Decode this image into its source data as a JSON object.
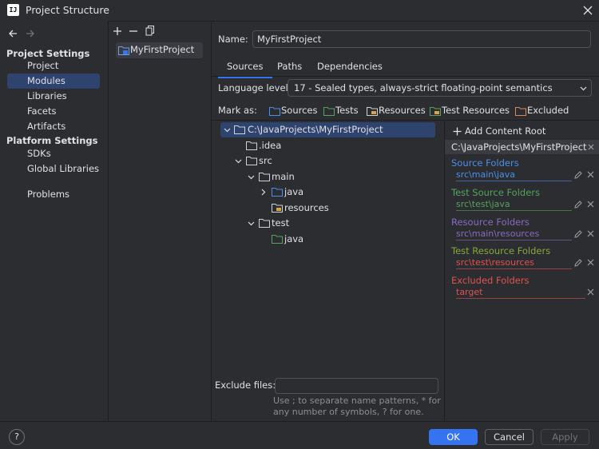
{
  "window": {
    "title": "Project Structure",
    "app_icon_text": "IJ"
  },
  "nav": {
    "project_settings_header": "Project Settings",
    "project_settings_items": [
      "Project",
      "Modules",
      "Libraries",
      "Facets",
      "Artifacts"
    ],
    "platform_settings_header": "Platform Settings",
    "platform_settings_items": [
      "SDKs",
      "Global Libraries"
    ],
    "problems": "Problems",
    "selected": "Modules"
  },
  "module_list": {
    "items": [
      "MyFirstProject"
    ]
  },
  "main": {
    "name_label": "Name:",
    "name_value": "MyFirstProject",
    "tabs": [
      "Sources",
      "Paths",
      "Dependencies"
    ],
    "active_tab": "Sources",
    "language_level_label": "Language level:",
    "language_level_value": "17 - Sealed types, always-strict floating-point semantics",
    "mark_as_label": "Mark as:",
    "mark_as": [
      "Sources",
      "Tests",
      "Resources",
      "Test Resources",
      "Excluded"
    ],
    "tree": [
      {
        "label": "C:\\JavaProjects\\MyFirstProject",
        "type": "root"
      },
      {
        "label": ".idea",
        "type": "folder"
      },
      {
        "label": "src",
        "type": "folder"
      },
      {
        "label": "main",
        "type": "folder"
      },
      {
        "label": "java",
        "type": "source"
      },
      {
        "label": "resources",
        "type": "resource"
      },
      {
        "label": "test",
        "type": "folder"
      },
      {
        "label": "java",
        "type": "test-source"
      }
    ],
    "exclude_files_label": "Exclude files:",
    "exclude_files_value": "",
    "exclude_hint": "Use ; to separate name patterns, * for any number of symbols, ? for one."
  },
  "content_root": {
    "add_label": "Add Content Root",
    "root_path": "C:\\JavaProjects\\MyFirstProject",
    "sections": [
      {
        "title": "Source Folders",
        "path": "src\\main\\java"
      },
      {
        "title": "Test Source Folders",
        "path": "src\\test\\java"
      },
      {
        "title": "Resource Folders",
        "path": "src\\main\\resources"
      },
      {
        "title": "Test Resource Folders",
        "path": "src\\test\\resources"
      },
      {
        "title": "Excluded Folders",
        "path": "target"
      }
    ]
  },
  "buttons": {
    "ok": "OK",
    "cancel": "Cancel",
    "apply": "Apply",
    "help": "?"
  },
  "colors": {
    "accent": "#3574f0",
    "sources": "#4e8ee8",
    "tests": "#55a35d",
    "resources": "#8a6ac0",
    "test_resources": "#86a93a",
    "excluded": "#e05252"
  }
}
